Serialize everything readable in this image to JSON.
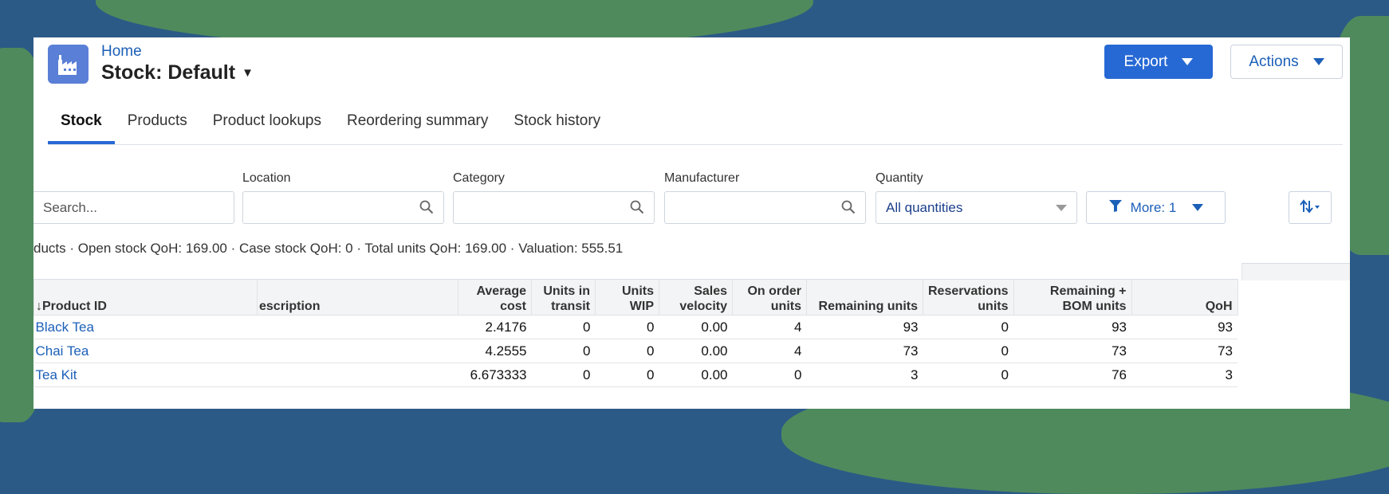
{
  "header": {
    "breadcrumb": "Home",
    "title": "Stock: Default",
    "export_label": "Export",
    "actions_label": "Actions"
  },
  "tabs": [
    {
      "label": "Stock",
      "active": true
    },
    {
      "label": "Products",
      "active": false
    },
    {
      "label": "Product lookups",
      "active": false
    },
    {
      "label": "Reordering summary",
      "active": false
    },
    {
      "label": "Stock history",
      "active": false
    }
  ],
  "filters": {
    "search_placeholder": "Search...",
    "location_label": "Location",
    "category_label": "Category",
    "manufacturer_label": "Manufacturer",
    "quantity_label": "Quantity",
    "quantity_value": "All quantities",
    "more_label": "More: 1"
  },
  "summary": "ducts · Open stock QoH: 169.00 · Case stock QoH: 0 · Total units QoH: 169.00 · Valuation: 555.51",
  "table": {
    "columns": [
      "Product ID",
      "escription",
      "Average cost",
      "Units in transit",
      "Units WIP",
      "Sales velocity",
      "On order units",
      "Remaining units",
      "Reservations units",
      "Remaining + BOM units",
      "QoH"
    ],
    "rows": [
      {
        "product": "Black Tea",
        "description": "",
        "avg_cost": "2.4176",
        "in_transit": "0",
        "wip": "0",
        "velocity": "0.00",
        "on_order": "4",
        "remaining": "93",
        "reservations": "0",
        "remaining_bom": "93",
        "qoh": "93"
      },
      {
        "product": "Chai Tea",
        "description": "",
        "avg_cost": "4.2555",
        "in_transit": "0",
        "wip": "0",
        "velocity": "0.00",
        "on_order": "4",
        "remaining": "73",
        "reservations": "0",
        "remaining_bom": "73",
        "qoh": "73"
      },
      {
        "product": "Tea Kit",
        "description": "",
        "avg_cost": "6.673333",
        "in_transit": "0",
        "wip": "0",
        "velocity": "0.00",
        "on_order": "0",
        "remaining": "3",
        "reservations": "0",
        "remaining_bom": "76",
        "qoh": "3"
      }
    ]
  },
  "colors": {
    "accent": "#2769d4",
    "link": "#1b5fb8",
    "background_map_water": "#2b5a86",
    "background_map_land": "#4f8a5c"
  },
  "icons": {
    "app": "factory-icon",
    "search": "magnifier-icon",
    "filter": "funnel-icon",
    "sort": "sort-arrows-icon"
  }
}
